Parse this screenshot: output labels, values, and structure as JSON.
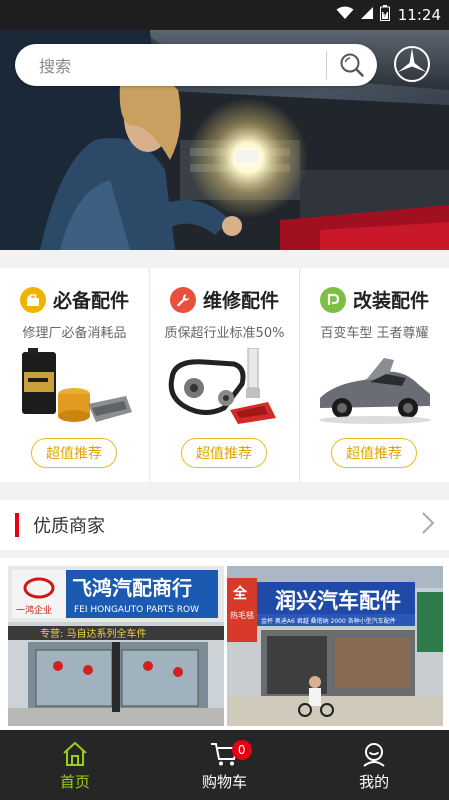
{
  "status_bar": {
    "time": "11:24"
  },
  "search": {
    "placeholder": "搜索"
  },
  "categories": [
    {
      "title": "必备配件",
      "subtitle": "修理厂必备消耗品",
      "button": "超值推荐",
      "icon": "toolbox-icon",
      "color": "#f0b400"
    },
    {
      "title": "维修配件",
      "subtitle": "质保超行业标准50%",
      "button": "超值推荐",
      "icon": "wrench-icon",
      "color": "#e8503c"
    },
    {
      "title": "改装配件",
      "subtitle": "百变车型 王者尊耀",
      "button": "超值推荐",
      "icon": "modify-icon",
      "color": "#7bc043"
    }
  ],
  "merchants": {
    "title": "优质商家",
    "shops": [
      {
        "sign": "飞鸿汽配商行",
        "sign_en": "FEI HONGAUTO PARTS ROW",
        "company": "一鸿企业",
        "banner": "专营: 马自达系列全车件"
      },
      {
        "sign": "润兴汽车配件",
        "sub": "金杯  奥迪A6  君越  桑塔纳  2000  各种小型汽车配件",
        "side": "全",
        "side2": "热毛毯"
      }
    ]
  },
  "nav": [
    {
      "label": "首页",
      "icon": "home-icon"
    },
    {
      "label": "购物车",
      "icon": "cart-icon",
      "badge": "0"
    },
    {
      "label": "我的",
      "icon": "user-icon"
    }
  ],
  "colors": {
    "accent": "#9acd1c",
    "button_border": "#e8b928",
    "red": "#e60012",
    "nav_bg": "#262626"
  }
}
